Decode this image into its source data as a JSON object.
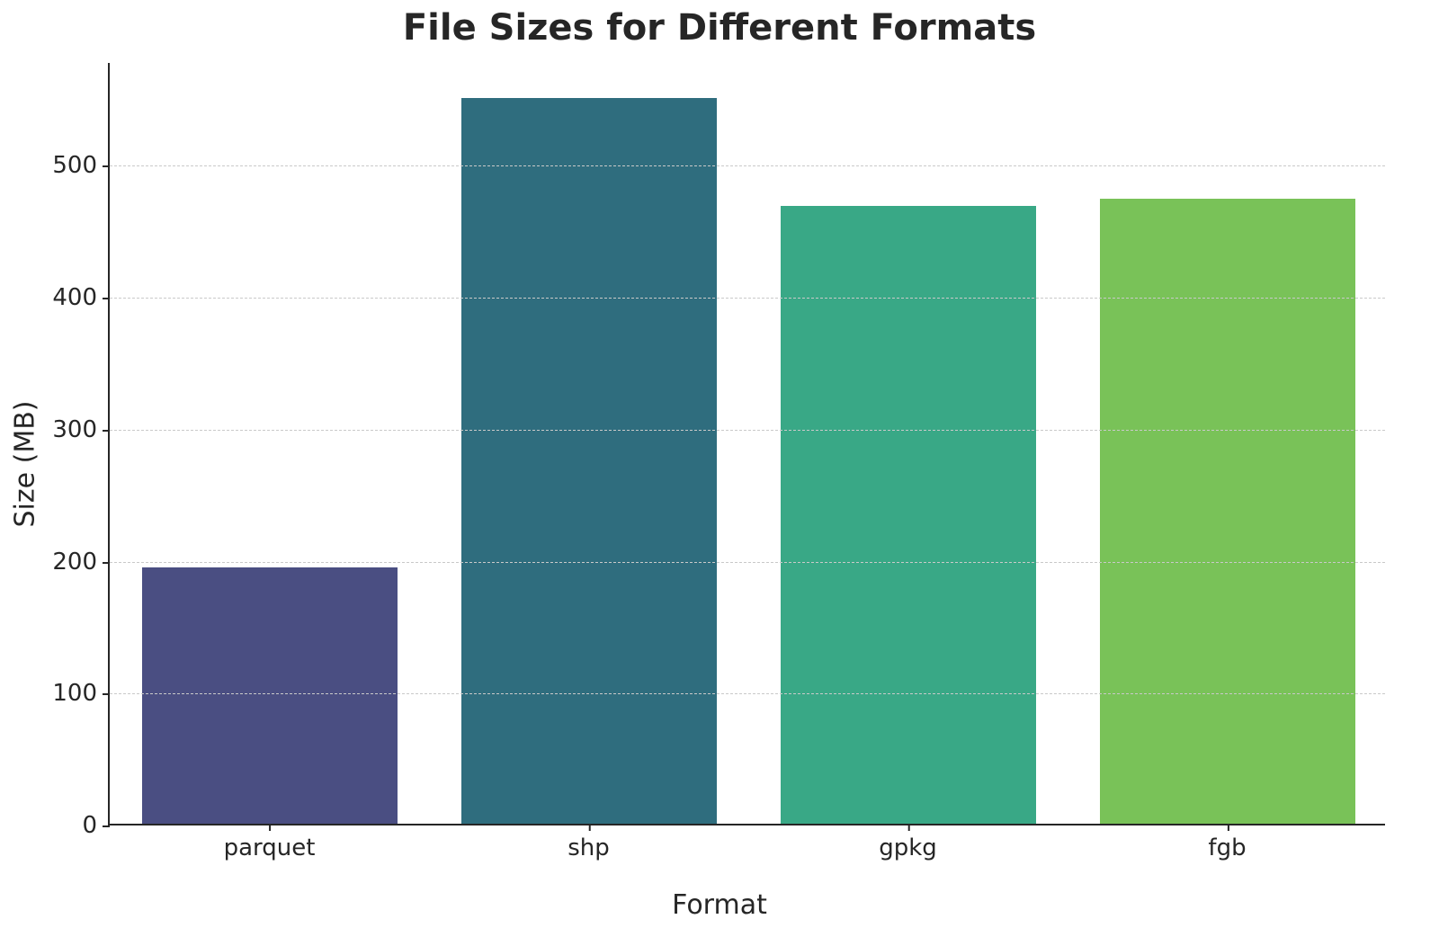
{
  "chart_data": {
    "type": "bar",
    "title": "File Sizes for Different Formats",
    "xlabel": "Format",
    "ylabel": "Size (MB)",
    "categories": [
      "parquet",
      "shp",
      "gpkg",
      "fgb"
    ],
    "values": [
      194,
      550,
      468,
      474
    ],
    "colors": [
      "#4a4e82",
      "#2f6d7e",
      "#39a886",
      "#79c258"
    ],
    "ylim": [
      0,
      578
    ],
    "y_ticks": [
      0,
      100,
      200,
      300,
      400,
      500
    ],
    "grid_ticks": [
      100,
      200,
      300,
      400,
      500
    ],
    "bar_width_fraction": 0.8
  }
}
